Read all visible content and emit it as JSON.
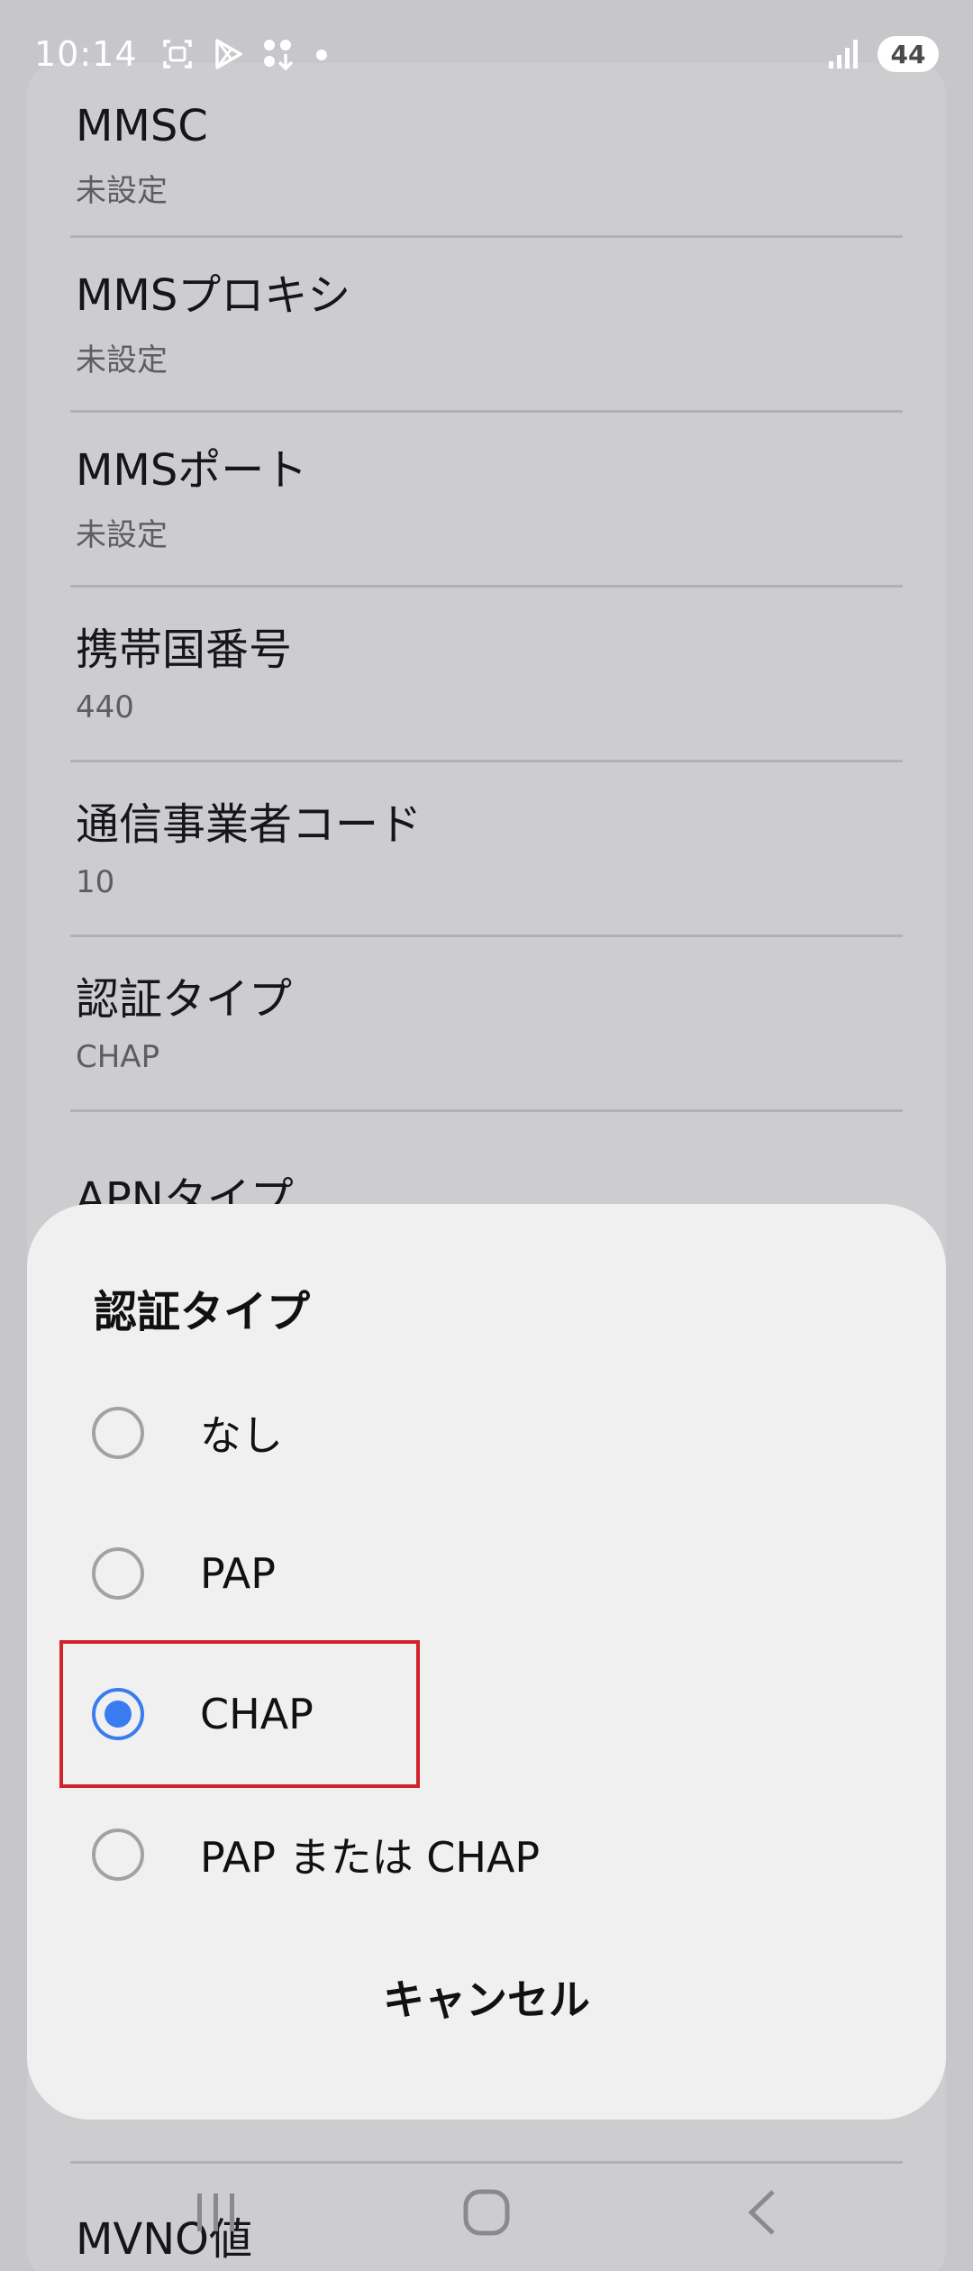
{
  "status_bar": {
    "time": "10:14",
    "battery": "44",
    "icons": [
      "screenshot-icon",
      "play-store-icon",
      "app-grid-icon",
      "notification-dot-icon",
      "signal-icon"
    ]
  },
  "settings": {
    "items": [
      {
        "title": "MMSC",
        "value": "未設定"
      },
      {
        "title": "MMSプロキシ",
        "value": "未設定"
      },
      {
        "title": "MMSポート",
        "value": "未設定"
      },
      {
        "title": "携帯国番号",
        "value": "440"
      },
      {
        "title": "通信事業者コード",
        "value": "10"
      },
      {
        "title": "認証タイプ",
        "value": "CHAP"
      },
      {
        "title": "APNタイプ",
        "value": ""
      }
    ],
    "bottom_item": "MVNO値"
  },
  "dialog": {
    "title": "認証タイプ",
    "options": [
      {
        "label": "なし",
        "selected": false
      },
      {
        "label": "PAP",
        "selected": false
      },
      {
        "label": "CHAP",
        "selected": true
      },
      {
        "label": "PAP または CHAP",
        "selected": false
      }
    ],
    "cancel_label": "キャンセル"
  },
  "colors": {
    "accent": "#3a7cf0",
    "highlight": "#d2232a"
  },
  "nav": {
    "icons": [
      "recent-apps-icon",
      "home-icon",
      "back-icon"
    ]
  }
}
